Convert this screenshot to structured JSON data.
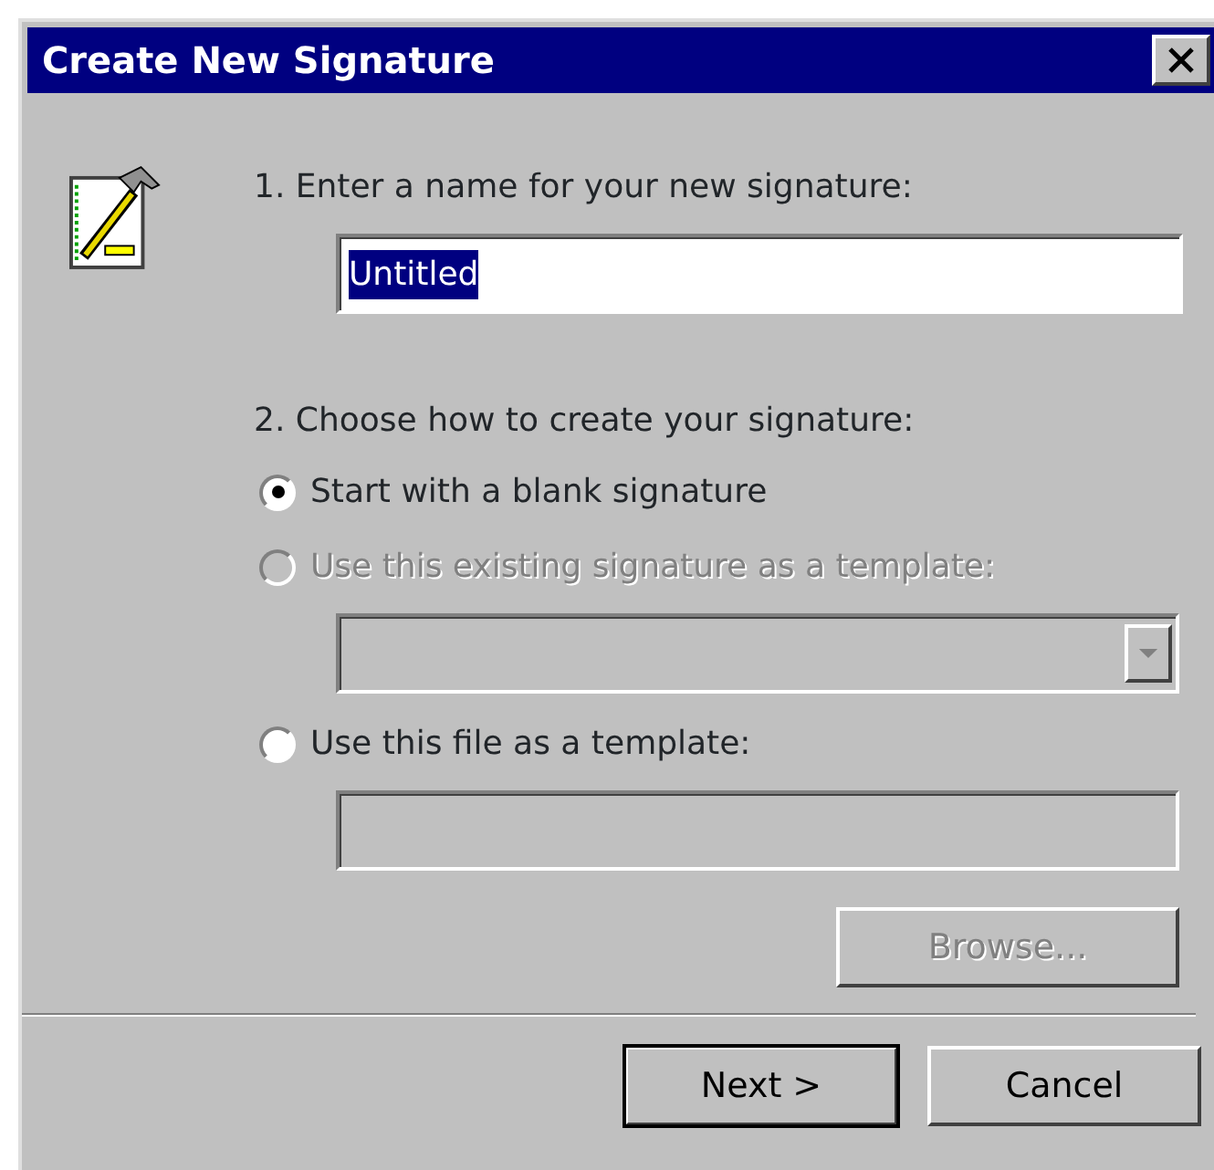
{
  "window": {
    "title": "Create New Signature"
  },
  "name_step": {
    "label": "1. Enter a name for your new signature:",
    "value": "Untitled",
    "value_selected": true
  },
  "method_step": {
    "label": "2. Choose how to create your signature:",
    "options": [
      {
        "kind": "plain",
        "label": "Start with a blank signature",
        "selected": true,
        "disabled": false
      },
      {
        "kind": "dropdown",
        "label": "Use this existing signature as a template:",
        "selected": false,
        "disabled": true,
        "control": {
          "disabled": true
        }
      },
      {
        "kind": "file",
        "label": "Use this file as a template:",
        "selected": false,
        "disabled": false,
        "control": {
          "disabled": true
        },
        "button": {
          "label": "Browse...",
          "disabled": true
        }
      }
    ]
  },
  "buttons": [
    {
      "label": "Next >",
      "default": true
    },
    {
      "label": "Cancel",
      "default": false
    }
  ]
}
